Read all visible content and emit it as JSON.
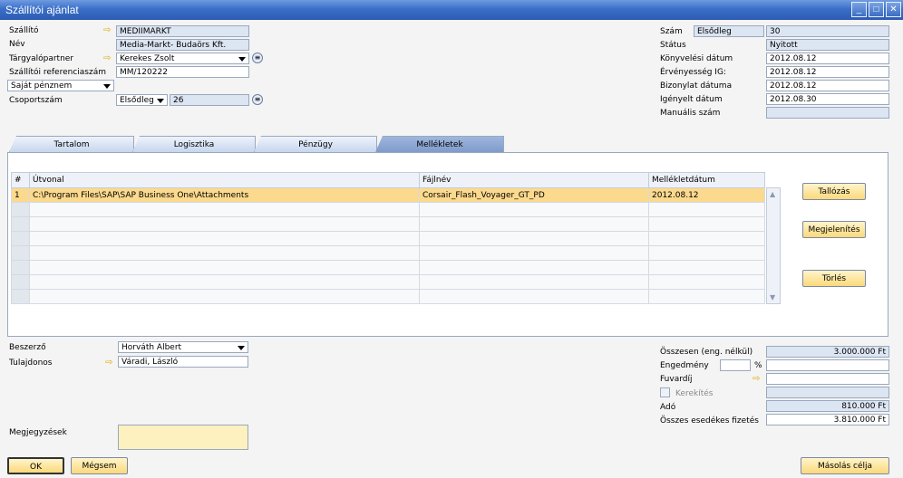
{
  "window": {
    "title": "Szállítói ajánlat"
  },
  "header_left": {
    "vendor": {
      "label": "Szállító",
      "value": "MEDIIMARKT"
    },
    "name": {
      "label": "Név",
      "value": "Media-Markt- Budaörs Kft."
    },
    "contact": {
      "label": "Tárgyalópartner",
      "value": "Kerekes Zsolt"
    },
    "vendor_ref": {
      "label": "Szállítói referenciaszám",
      "value": "MM/120222"
    },
    "currency": {
      "value": "Saját pénznem"
    },
    "group": {
      "label": "Csoportszám",
      "select": "Elsődleg",
      "value": "26"
    }
  },
  "header_right": {
    "number": {
      "label": "Szám",
      "series": "Elsődleg",
      "value": "30"
    },
    "status": {
      "label": "Státus",
      "value": "Nyitott"
    },
    "posting_date": {
      "label": "Könyvelési dátum",
      "value": "2012.08.12"
    },
    "valid_until": {
      "label": "Érvényesség IG:",
      "value": "2012.08.12"
    },
    "document_date": {
      "label": "Bizonylat dátuma",
      "value": "2012.08.12"
    },
    "required_date": {
      "label": "Igényelt dátum",
      "value": "2012.08.30"
    },
    "manual_number": {
      "label": "Manuális szám",
      "value": ""
    }
  },
  "tabs": [
    {
      "label": "Tartalom"
    },
    {
      "label": "Logisztika"
    },
    {
      "label": "Pénzügy"
    },
    {
      "label": "Mellékletek"
    }
  ],
  "attachments": {
    "columns": [
      "#",
      "Útvonal",
      "Fájlnév",
      "Mellékletdátum"
    ],
    "rows": [
      {
        "num": "1",
        "path": "C:\\Program Files\\SAP\\SAP Business One\\Attachments",
        "file": "Corsair_Flash_Voyager_GT_PD",
        "date": "2012.08.12"
      }
    ],
    "buttons": {
      "browse": "Tallózás",
      "display": "Megjelenítés",
      "delete": "Törlés"
    }
  },
  "footer_left": {
    "buyer": {
      "label": "Beszerző",
      "value": "Horváth Albert"
    },
    "owner": {
      "label": "Tulajdonos",
      "value": "Váradi, László"
    },
    "remarks": {
      "label": "Megjegyzések",
      "value": ""
    }
  },
  "totals": {
    "before_discount": {
      "label": "Összesen (eng. nélkül)",
      "value": "3.000.000 Ft"
    },
    "discount": {
      "label": "Engedmény",
      "percent_sign": "%",
      "value": ""
    },
    "freight": {
      "label": "Fuvardíj",
      "value": ""
    },
    "rounding": {
      "label": "Kerekítés",
      "value": ""
    },
    "tax": {
      "label": "Adó",
      "value": "810.000 Ft"
    },
    "total": {
      "label": "Összes esedékes fizetés",
      "value": "3.810.000 Ft"
    }
  },
  "buttons": {
    "ok": "OK",
    "cancel": "Mégsem",
    "copy_to": "Másolás célja"
  },
  "colors": {
    "title_bar": "#3a6fc8",
    "selected_row": "#fbd98d",
    "button": "#fbd97a",
    "readonly": "#dce5f2"
  }
}
